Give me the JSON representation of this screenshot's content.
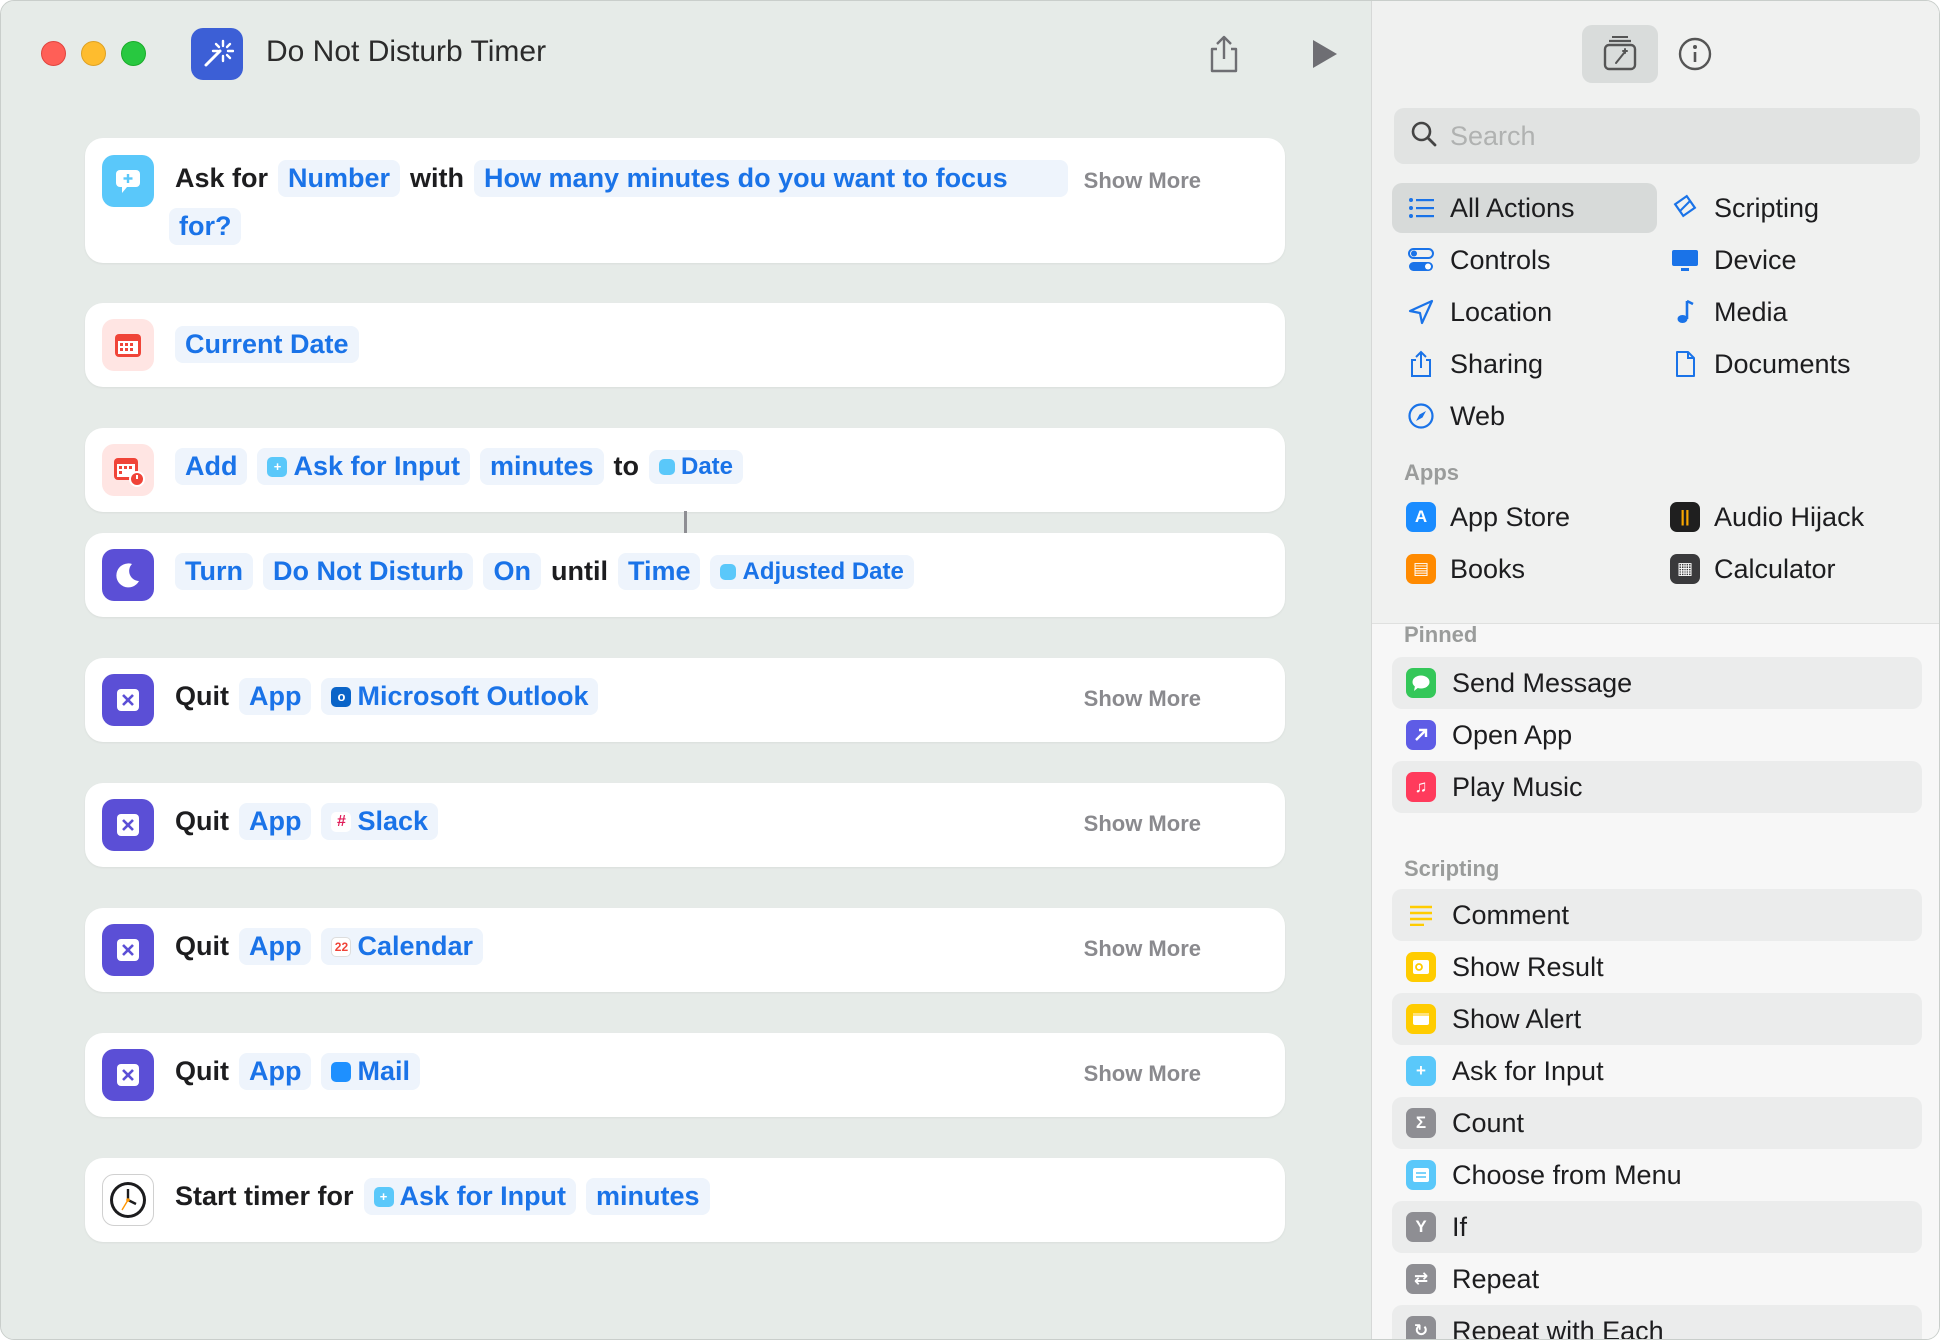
{
  "window": {
    "title": "Do Not Disturb Timer"
  },
  "actions": {
    "ask": {
      "kw": "Ask for",
      "type": "Number",
      "with": "with",
      "prompt_line1": "How many minutes do you want to focus",
      "prompt_line2": "for?",
      "show_more": "Show More"
    },
    "current_date": {
      "label": "Current Date"
    },
    "add": {
      "verb": "Add",
      "var": "Ask for Input",
      "unit": "minutes",
      "to": "to",
      "target": "Date"
    },
    "dnd": {
      "turn": "Turn",
      "feature": "Do Not Disturb",
      "state": "On",
      "until": "until",
      "time": "Time",
      "date": "Adjusted Date"
    },
    "quits": [
      {
        "kw": "Quit",
        "app_token": "App",
        "app_name": "Microsoft Outlook",
        "show_more": "Show More"
      },
      {
        "kw": "Quit",
        "app_token": "App",
        "app_name": "Slack",
        "show_more": "Show More"
      },
      {
        "kw": "Quit",
        "app_token": "App",
        "app_name": "Calendar",
        "show_more": "Show More"
      },
      {
        "kw": "Quit",
        "app_token": "App",
        "app_name": "Mail",
        "show_more": "Show More"
      }
    ],
    "timer": {
      "kw": "Start timer for",
      "var": "Ask for Input",
      "unit": "minutes"
    }
  },
  "sidebar": {
    "search_placeholder": "Search",
    "categories": [
      {
        "label": "All Actions",
        "icon": "list-icon"
      },
      {
        "label": "Scripting",
        "icon": "scripting-icon"
      },
      {
        "label": "Controls",
        "icon": "toggles-icon"
      },
      {
        "label": "Device",
        "icon": "display-icon"
      },
      {
        "label": "Location",
        "icon": "location-arrow-icon"
      },
      {
        "label": "Media",
        "icon": "music-note-icon"
      },
      {
        "label": "Sharing",
        "icon": "share-icon"
      },
      {
        "label": "Documents",
        "icon": "document-icon"
      },
      {
        "label": "Web",
        "icon": "compass-icon"
      }
    ],
    "apps_header": "Apps",
    "apps": [
      {
        "label": "App Store",
        "color": "#1a8cff"
      },
      {
        "label": "Audio Hijack",
        "color": "#1f1f1f"
      },
      {
        "label": "Books",
        "color": "#ff8a00"
      },
      {
        "label": "Calculator",
        "color": "#3a3a3c"
      }
    ],
    "pinned_header": "Pinned",
    "pinned": [
      {
        "label": "Send Message",
        "color": "#34c759"
      },
      {
        "label": "Open App",
        "color": "#5e5ce6"
      },
      {
        "label": "Play Music",
        "color": "#ff3b5c"
      }
    ],
    "scripting_header": "Scripting",
    "scripting": [
      {
        "label": "Comment",
        "color": "#ffcc00"
      },
      {
        "label": "Show Result",
        "color": "#ffcc00"
      },
      {
        "label": "Show Alert",
        "color": "#ffcc00"
      },
      {
        "label": "Ask for Input",
        "color": "#5ac8fa"
      },
      {
        "label": "Count",
        "color": "#8e8e93"
      },
      {
        "label": "Choose from Menu",
        "color": "#5ac8fa"
      },
      {
        "label": "If",
        "color": "#8e8e93"
      },
      {
        "label": "Repeat",
        "color": "#8e8e93"
      },
      {
        "label": "Repeat with Each",
        "color": "#8e8e93"
      }
    ]
  },
  "colors": {
    "accent": "#1a73e8",
    "editor_bg": "#e6ebe8",
    "quit_icon": "#5b4fd6",
    "dnd_icon": "#5b4fd6",
    "calendar_icon": "#f04438",
    "ask_icon": "#5ac8fa"
  }
}
